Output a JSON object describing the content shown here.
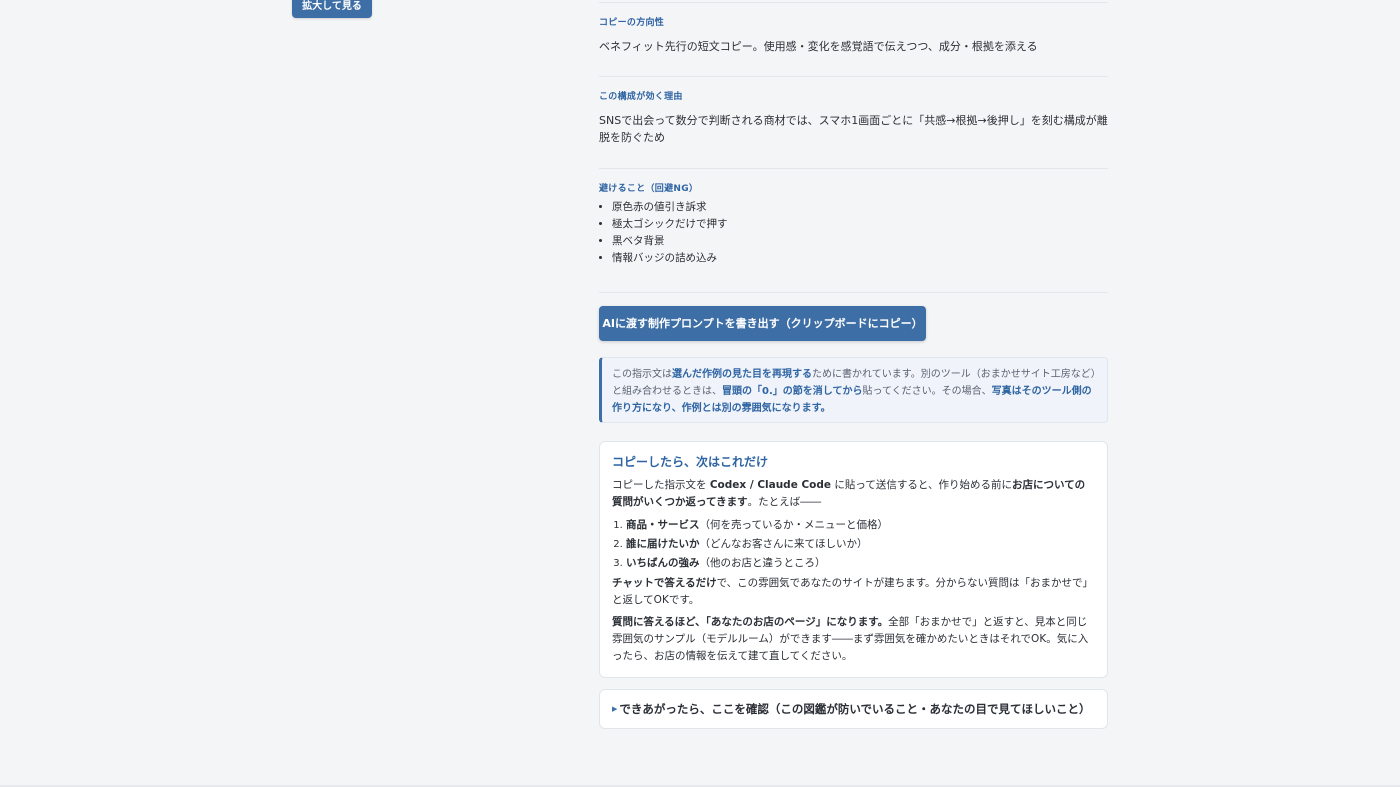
{
  "zoom_button_label": "拡大して見る",
  "sections": {
    "copy_direction": {
      "label": "コピーの方向性",
      "text": "ベネフィット先行の短文コピー。使用感・変化を感覚語で伝えつつ、成分・根拠を添える"
    },
    "reason": {
      "label": "この構成が効く理由",
      "text": "SNSで出会って数分で判断される商材では、スマホ1画面ごとに「共感→根拠→後押し」を刻む構成が離脱を防ぐため"
    },
    "avoid": {
      "label": "避けること（回避NG）",
      "items": [
        "原色赤の値引き訴求",
        "極太ゴシックだけで押す",
        "黒ベタ背景",
        "情報バッジの詰め込み"
      ]
    }
  },
  "prompt_button_label": "AIに渡す制作プロンプトを書き出す（クリップボードにコピー）",
  "notice": {
    "t1": "この指示文は",
    "b1": "選んだ作例の見た目を再現する",
    "t2": "ために書かれています。別のツール（おまかせサイト工房など）と組み合わせるときは、",
    "b2": "冒頭の「0.」の節を消してから",
    "t3": "貼ってください。その場合、",
    "b3": "写真はそのツール側の作り方になり、作例とは別の雰囲気になります。"
  },
  "next_steps": {
    "title": "コピーしたら、次はこれだけ",
    "p1_t1": "コピーした指示文を ",
    "p1_b1": "Codex / Claude Code",
    "p1_t2": " に貼って送信すると、作り始める前に",
    "p1_b2": "お店についての質問がいくつか返ってきます",
    "p1_t3": "。たとえば――",
    "items": [
      {
        "bold": "商品・サービス",
        "rest": "（何を売っているか・メニューと価格）"
      },
      {
        "bold": "誰に届けたいか",
        "rest": "（どんなお客さんに来てほしいか）"
      },
      {
        "bold": "いちばんの強み",
        "rest": "（他のお店と違うところ）"
      }
    ],
    "p2_b": "チャットで答えるだけ",
    "p2_t": "で、この雰囲気であなたのサイトが建ちます。分からない質問は「おまかせで」と返してOKです。",
    "p3_b": "質問に答えるほど、「あなたのお店のページ」になります。",
    "p3_t": "全部「おまかせで」と返すと、見本と同じ雰囲気のサンプル（モデルルーム）ができます――まず雰囲気を確かめたいときはそれでOK。気に入ったら、お店の情報を伝えて建て直してください。"
  },
  "details_summary": "できあがったら、ここを確認（この図鑑が防いでいること・あなたの目で見てほしいこと）"
}
